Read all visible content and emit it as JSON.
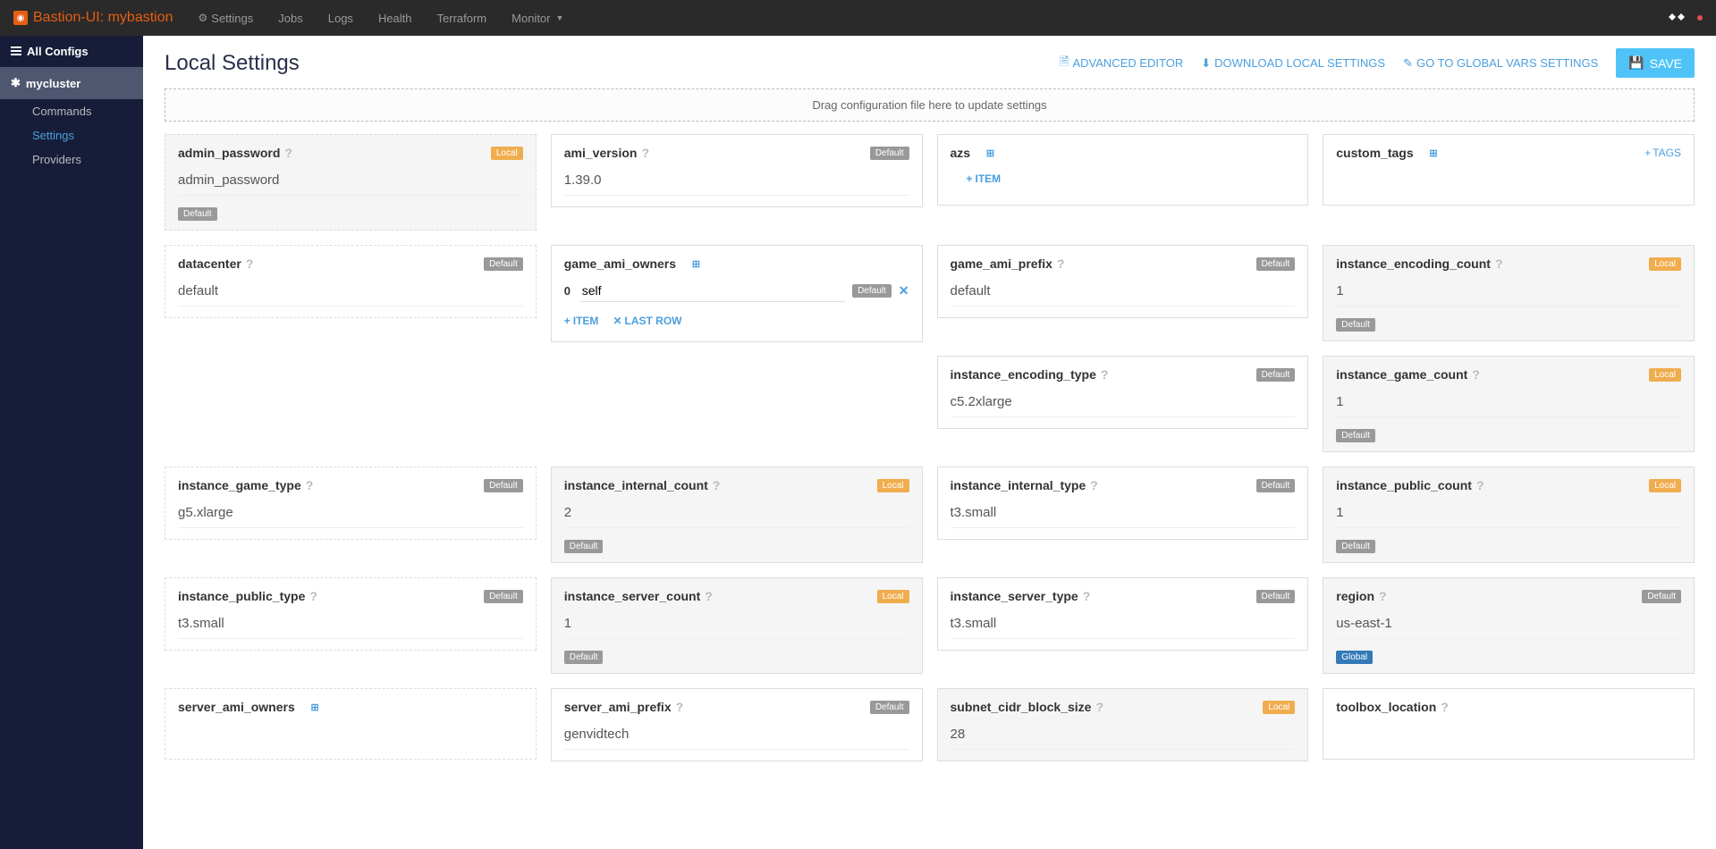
{
  "navbar": {
    "brand": "Bastion-UI: mybastion",
    "items": [
      {
        "label": "Settings",
        "icon": "gear"
      },
      {
        "label": "Jobs"
      },
      {
        "label": "Logs"
      },
      {
        "label": "Health"
      },
      {
        "label": "Terraform"
      },
      {
        "label": "Monitor",
        "dropdown": true
      }
    ]
  },
  "sidebar": {
    "all_configs": "All Configs",
    "cluster": "mycluster",
    "subitems": [
      {
        "label": "Commands",
        "active": false
      },
      {
        "label": "Settings",
        "active": true
      },
      {
        "label": "Providers",
        "active": false
      }
    ]
  },
  "page": {
    "title": "Local Settings",
    "toolbar": {
      "advanced": "ADVANCED EDITOR",
      "download": "DOWNLOAD LOCAL SETTINGS",
      "global": "GO TO GLOBAL VARS SETTINGS",
      "save": "SAVE"
    },
    "dropzone": "Drag configuration file here to update settings"
  },
  "labels": {
    "item": "ITEM",
    "tags": "TAGS",
    "last_row": "LAST ROW",
    "default_badge": "Default",
    "local_badge": "Local",
    "global_badge": "Global"
  },
  "cards": {
    "admin_password": {
      "title": "admin_password",
      "value": "admin_password",
      "badge": "Local",
      "footer_badge": "Default",
      "modified": true,
      "dashed": true
    },
    "ami_version": {
      "title": "ami_version",
      "value": "1.39.0",
      "badge": "Default"
    },
    "azs": {
      "title": "azs",
      "expand": true,
      "add_item": true
    },
    "custom_tags": {
      "title": "custom_tags",
      "expand": true,
      "tags_action": true
    },
    "datacenter": {
      "title": "datacenter",
      "value": "default",
      "badge": "Default",
      "dashed": true
    },
    "game_ami_owners": {
      "title": "game_ami_owners",
      "expand": true,
      "rows": [
        {
          "idx": "0",
          "val": "self",
          "badge": "Default"
        }
      ],
      "add_item": true,
      "last_row": true
    },
    "game_ami_prefix": {
      "title": "game_ami_prefix",
      "value": "default",
      "badge": "Default"
    },
    "instance_encoding_count": {
      "title": "instance_encoding_count",
      "value": "1",
      "badge": "Local",
      "footer_badge": "Default",
      "modified": true
    },
    "instance_encoding_type": {
      "title": "instance_encoding_type",
      "value": "c5.2xlarge",
      "badge": "Default"
    },
    "instance_game_count": {
      "title": "instance_game_count",
      "value": "1",
      "badge": "Local",
      "footer_badge": "Default",
      "modified": true
    },
    "instance_game_type": {
      "title": "instance_game_type",
      "value": "g5.xlarge",
      "badge": "Default",
      "dashed": true
    },
    "instance_internal_count": {
      "title": "instance_internal_count",
      "value": "2",
      "badge": "Local",
      "footer_badge": "Default",
      "modified": true
    },
    "instance_internal_type": {
      "title": "instance_internal_type",
      "value": "t3.small",
      "badge": "Default"
    },
    "instance_public_count": {
      "title": "instance_public_count",
      "value": "1",
      "badge": "Local",
      "footer_badge": "Default",
      "modified": true
    },
    "instance_public_type": {
      "title": "instance_public_type",
      "value": "t3.small",
      "badge": "Default",
      "dashed": true
    },
    "instance_server_count": {
      "title": "instance_server_count",
      "value": "1",
      "badge": "Local",
      "footer_badge": "Default",
      "modified": true
    },
    "instance_server_type": {
      "title": "instance_server_type",
      "value": "t3.small",
      "badge": "Default"
    },
    "region": {
      "title": "region",
      "value": "us-east-1",
      "badge": "Default",
      "footer_badge": "Global",
      "modified": true
    },
    "server_ami_owners": {
      "title": "server_ami_owners",
      "expand": true,
      "dashed": true
    },
    "server_ami_prefix": {
      "title": "server_ami_prefix",
      "value": "genvidtech",
      "badge": "Default"
    },
    "subnet_cidr_block_size": {
      "title": "subnet_cidr_block_size",
      "value": "28",
      "badge": "Local",
      "modified": true
    },
    "toolbox_location": {
      "title": "toolbox_location"
    }
  }
}
